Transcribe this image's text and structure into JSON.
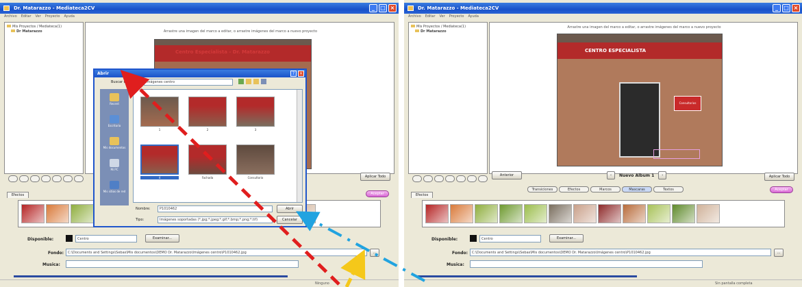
{
  "left": {
    "window_title": "Dr. Matarazzo - Mediateca2CV",
    "menu": [
      "Archivo",
      "Editar",
      "Ver",
      "Proyecto",
      "Ayuda"
    ],
    "tree": [
      "Mis Proyectos / Mediateca(1)",
      "Dr Matarazzo"
    ],
    "hint": "Arrastre una imagen del marco a editar, o arrastre imágenes del marco a nuevo proyecto",
    "canvas_banner": "Centro Especialista - Dr. Matarazzo",
    "dialog": {
      "title": "Abrir",
      "look_in_label": "Buscar en:",
      "look_in_value": "Imágenes centro",
      "places": [
        "Recent",
        "Escritorio",
        "Mis documentos",
        "Mi PC",
        "Mis sitios de red"
      ],
      "files": [
        "1",
        "2",
        "3",
        "4",
        "Fachada",
        "Consultorio"
      ],
      "filename_label": "Nombre:",
      "filename_value": "P1010462",
      "filetype_label": "Tipo:",
      "filetype_value": "Imágenes soportadas (*.jpg;*.jpeg;*.gif;*.bmp;*.png;*.tif)",
      "open_button": "Abrir",
      "cancel_button": "Cancelar"
    },
    "update_button": "Aplicar Todo",
    "tab_label": "Efectos",
    "accept_button": "Aceptar",
    "disponible_label": "Disponible:",
    "disponible_value": "Centro",
    "disponible_button": "Examinar...",
    "fondo_label": "Fondo:",
    "fondo_value": "C:\\Documents and Settings\\Sebas\\Mis documentos\\DEMO Dr. Matarazzo\\Imágenes centro\\P1010462.jpg",
    "musica_label": "Musica:",
    "status_text": "Ninguno"
  },
  "right": {
    "window_title": "Dr. Matarazzo - Mediateca2CV",
    "menu": [
      "Archivo",
      "Editar",
      "Ver",
      "Proyecto",
      "Ayuda"
    ],
    "tree": [
      "Mis Proyectos / Mediateca(1)",
      "Dr Matarazzo"
    ],
    "hint": "Arrastre una imagen del marco a editar, o arrastre imágenes del marco a nuevo proyecto",
    "canvas_banner": "CENTRO ESPECIALISTA",
    "canvas_sign": "Consultorios",
    "nav_label": "Nuevo Album 1",
    "prev_button": "Anterior",
    "update_button": "Aplicar Todo",
    "tabs": [
      "Transiciones",
      "Efectos",
      "Marcos",
      "Mascaras",
      "Textos"
    ],
    "active_tab": "Mascaras",
    "tab_label": "Efectos",
    "accept_button": "Aceptar",
    "disponible_label": "Disponible:",
    "disponible_value": "Centro",
    "disponible_button": "Examinar...",
    "fondo_label": "Fondo:",
    "fondo_value": "C:\\Documents and Settings\\Sebas\\Mis documentos\\DEMO Dr. Matarazzo\\Imágenes centro\\P1010462.jpg",
    "musica_label": "Musica:",
    "status_text": "Sin pantalla completa"
  },
  "thumb_colors": [
    "#b52424",
    "#d97a3a",
    "#8fae3e",
    "#6e9a2f",
    "#9bbd4c",
    "#7a6e5e",
    "#c9a08a",
    "#8e2a2a",
    "#b86b3a",
    "#a8c25a",
    "#5f8a2b",
    "#d0b29a"
  ],
  "annotation_colors": {
    "red": "#e01e1e",
    "blue": "#21a3e0",
    "yellow": "#f5c81a"
  }
}
